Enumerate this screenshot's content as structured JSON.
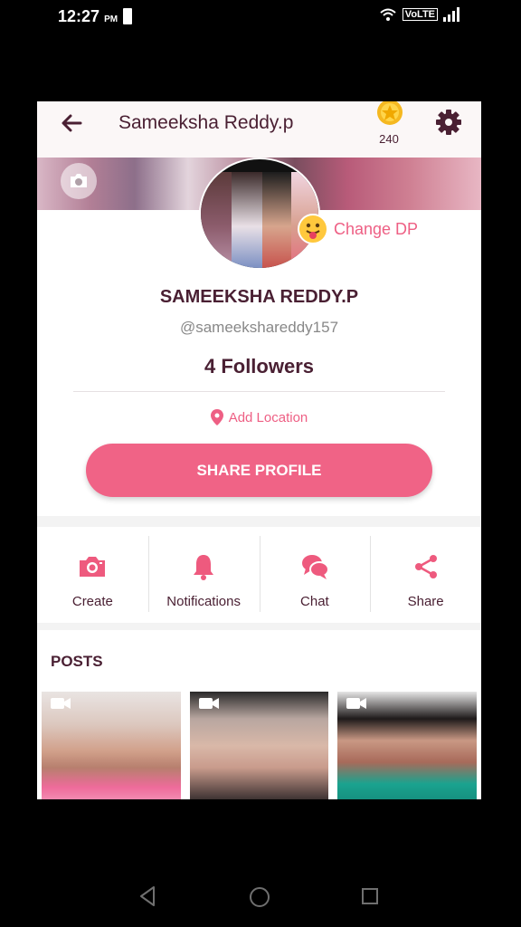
{
  "status": {
    "time": "12:27",
    "ampm": "PM",
    "volte": "VoLTE"
  },
  "topbar": {
    "title": "Sameeksha Reddy.p",
    "coins": "240"
  },
  "profile": {
    "change_dp": "Change DP",
    "name": "SAMEEKSHA REDDY.P",
    "handle": "@sameekshareddy157",
    "followers": "4 Followers",
    "location": "Add Location",
    "share_profile": "SHARE PROFILE"
  },
  "actions": [
    {
      "label": "Create",
      "icon": "camera-icon"
    },
    {
      "label": "Notifications",
      "icon": "bell-icon"
    },
    {
      "label": "Chat",
      "icon": "chat-icon"
    },
    {
      "label": "Share",
      "icon": "share-icon"
    }
  ],
  "posts": {
    "title": "POSTS"
  },
  "colors": {
    "accent": "#f06386",
    "title": "#4a2033"
  }
}
